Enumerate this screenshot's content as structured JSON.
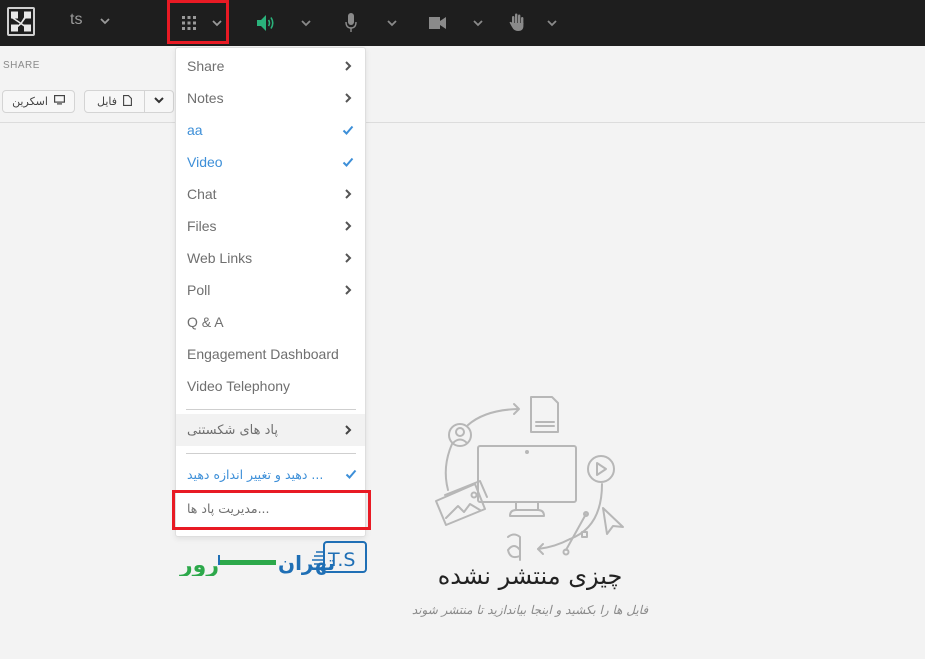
{
  "topbar": {
    "app_title": "ts",
    "icons": {
      "logo": "app-logo-icon",
      "apps": "apps-grid-icon",
      "speaker": "speaker-icon",
      "mic": "microphone-icon",
      "camera": "camera-icon",
      "hand": "raise-hand-icon"
    },
    "speaker_color": "#2ab27b",
    "icon_color": "#8a8a8a"
  },
  "share_panel": {
    "label": "SHARE",
    "screen_button": "اسکرین",
    "file_button": "فایل"
  },
  "menu": {
    "items": [
      {
        "label": "Share",
        "indicator": "chevron",
        "active": false
      },
      {
        "label": "Notes",
        "indicator": "chevron",
        "active": false
      },
      {
        "label": "aa",
        "indicator": "check",
        "active": true
      },
      {
        "label": "Video",
        "indicator": "check",
        "active": true
      },
      {
        "label": "Chat",
        "indicator": "chevron",
        "active": false
      },
      {
        "label": "Files",
        "indicator": "chevron",
        "active": false
      },
      {
        "label": "Web Links",
        "indicator": "chevron",
        "active": false
      },
      {
        "label": "Poll",
        "indicator": "chevron",
        "active": false
      },
      {
        "label": "Q & A",
        "indicator": "",
        "active": false
      },
      {
        "label": "Engagement Dashboard",
        "indicator": "",
        "active": false
      },
      {
        "label": "Video Telephony",
        "indicator": "",
        "active": false
      }
    ],
    "breakout_pods": "پاد های شکستنی",
    "resize_pods": "... دهید و تغییر اندازه دهید",
    "manage_pods": "...مدیریت پاد ها",
    "active_color": "#3d8fd8",
    "highlight_color": "#e81a24"
  },
  "watermark": {
    "text": "تهران",
    "suffix": "رور",
    "mark": "T.S"
  },
  "empty_state": {
    "title": "چیزی منتشر نشده",
    "subtitle": "فایل ها را بکشید و اینجا بیاندازید تا منتشر شوند"
  }
}
